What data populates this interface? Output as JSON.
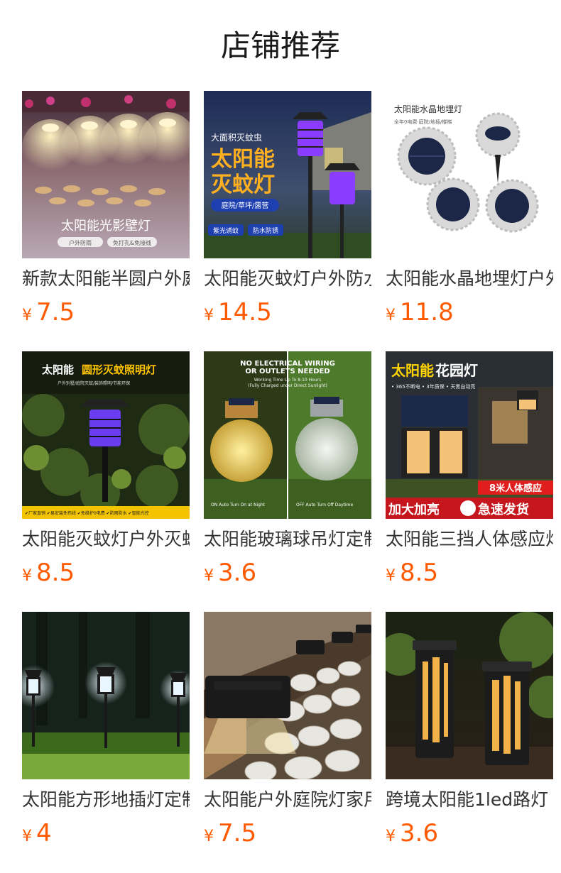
{
  "page": {
    "title": "店铺推荐"
  },
  "colors": {
    "price": "#ff5a00",
    "title": "#1a1a1a"
  },
  "products": [
    {
      "name": "新款太阳能半圆户外庭院壁灯",
      "currency": "¥",
      "price": "7.5",
      "image_text": {
        "headline": "太阳能光影壁灯",
        "tag1": "户外防雨",
        "tag2": "免打孔&免接线"
      }
    },
    {
      "name": "太阳能灭蚊灯户外防水庭院",
      "currency": "¥",
      "price": "14.5",
      "image_text": {
        "top": "大面积灭蚊虫",
        "line1": "太阳能",
        "line2": "灭蚊灯",
        "sub": "庭院/草坪/露营",
        "tag1": "紫光诱蚊",
        "tag2": "防水防锈"
      }
    },
    {
      "name": "太阳能水晶地埋灯户外",
      "currency": "¥",
      "price": "11.8",
      "image_text": {
        "title": "太阳能水晶地埋灯",
        "sub": "全年0电费·庭院/地插/楼梯"
      }
    },
    {
      "name": "太阳能灭蚊灯户外灭蚊照明",
      "currency": "¥",
      "price": "8.5",
      "image_text": {
        "title1": "太阳能",
        "title2": "圆形灭蚊照明灯",
        "sub": "户外别墅/庭院灭蚊/装饰照明/节能环保",
        "bar": "✔厂家直销 ✔易安装免布线 ✔免维护0电费 ✔防雨防水 ✔智能光控"
      }
    },
    {
      "name": "太阳能玻璃球吊灯定制",
      "currency": "¥",
      "price": "3.6",
      "image_text": {
        "line1": "NO ELECTRICAL WIRING",
        "line2": "OR OUTLETS NEEDED",
        "sub1": "Working Time Up To 8-10 Hours",
        "sub2": "(Fully Charged under Direct Sunlight)",
        "left": "ON Auto Turn On at Night",
        "right": "OFF Auto Turn Off Daytime"
      }
    },
    {
      "name": "太阳能三挡人体感应灯",
      "currency": "¥",
      "price": "8.5",
      "image_text": {
        "title1": "太阳能",
        "title2": "花园灯",
        "sub": "• 365不断电 • 3年质保 • 天黑自动亮",
        "badge": "8米人体感应",
        "bottom1": "加大加亮",
        "bottom2": "急速发货"
      }
    },
    {
      "name": "太阳能方形地插灯定制",
      "currency": "¥",
      "price": "4"
    },
    {
      "name": "太阳能户外庭院灯家用",
      "currency": "¥",
      "price": "7.5"
    },
    {
      "name": "跨境太阳能1led路灯",
      "currency": "¥",
      "price": "3.6"
    }
  ]
}
